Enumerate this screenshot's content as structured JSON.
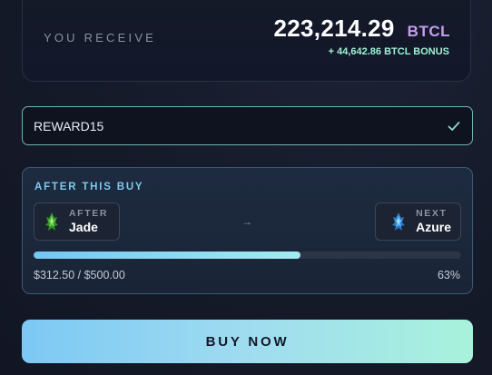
{
  "receive": {
    "label": "YOU RECEIVE",
    "amount": "223,214.29",
    "unit": "BTCL",
    "bonus": "+ 44,642.86 BTCL BONUS"
  },
  "promo": {
    "value": "REWARD15",
    "valid": true,
    "icon": "check-icon"
  },
  "after_buy": {
    "title": "AFTER THIS BUY",
    "current_tier": {
      "caption": "AFTER",
      "name": "Jade",
      "icon": "jade-gem-icon",
      "color": "#3fae3a"
    },
    "next_tier": {
      "caption": "NEXT",
      "name": "Azure",
      "icon": "azure-gem-icon",
      "color": "#5fb8f0"
    },
    "arrow": "→",
    "progress": {
      "amount_text": "$312.50 / $500.00",
      "percent_text": "63%",
      "fraction": 0.625
    }
  },
  "buy_button": {
    "label": "BUY NOW"
  },
  "colors": {
    "accent_purple": "#c79cf2",
    "bonus_green": "#9ff2d6",
    "progress_start": "#74c7f2",
    "progress_end": "#a2ecf0"
  }
}
